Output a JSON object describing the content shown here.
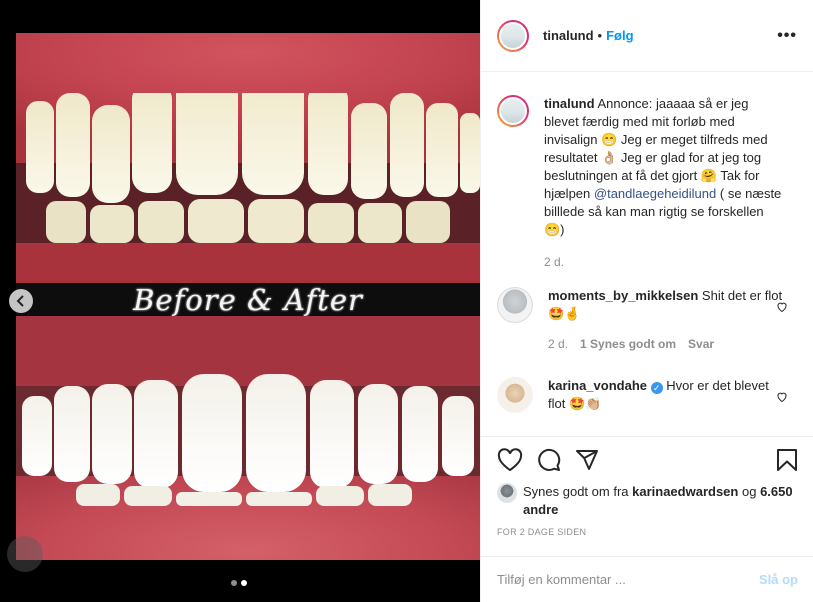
{
  "media": {
    "banner_text": "Before & After",
    "carousel_total": 2,
    "carousel_active": 2
  },
  "post": {
    "author": "tinalund",
    "separator": "•",
    "follow_label": "Følg",
    "more_label": "•••"
  },
  "caption": {
    "author": "tinalund",
    "text_1": "Annonce: jaaaaa så er jeg blevet færdig med mit forløb med invisalign 😁 Jeg er meget tilfreds med resultatet 👌🏼 Jeg er glad for at jeg tog beslutningen at få det gjort 🤗",
    "text_2": "Tak for hjælpen",
    "mention": "@tandlaegeheidilund",
    "text_3": "( se næste billlede så kan man rigtig se forskellen 😁)",
    "time": "2 d."
  },
  "comments": [
    {
      "author": "moments_by_mikkelsen",
      "text": "Shit det er flot 🤩🤞",
      "time": "2 d.",
      "likes": "1 Synes godt om",
      "reply": "Svar"
    },
    {
      "author": "karina_vondahe",
      "verified": "✓",
      "text": "Hvor er det blevet flot 🤩👏🏼"
    }
  ],
  "likes": {
    "prefix": "Synes godt om fra",
    "user": "karinaedwardsen",
    "connector": "og",
    "count": "6.650 andre"
  },
  "timestamp": "FOR 2 DAGE SIDEN",
  "comment_box": {
    "placeholder": "Tilføj en kommentar ...",
    "post_label": "Slå op"
  },
  "colors": {
    "link": "#0095f6",
    "mention": "#385185",
    "muted": "#8e8e8e",
    "post_disabled": "#b3dbff"
  },
  "icons": [
    "chevron-left-icon",
    "heart-icon",
    "comment-icon",
    "share-icon",
    "bookmark-icon",
    "verified-icon"
  ]
}
